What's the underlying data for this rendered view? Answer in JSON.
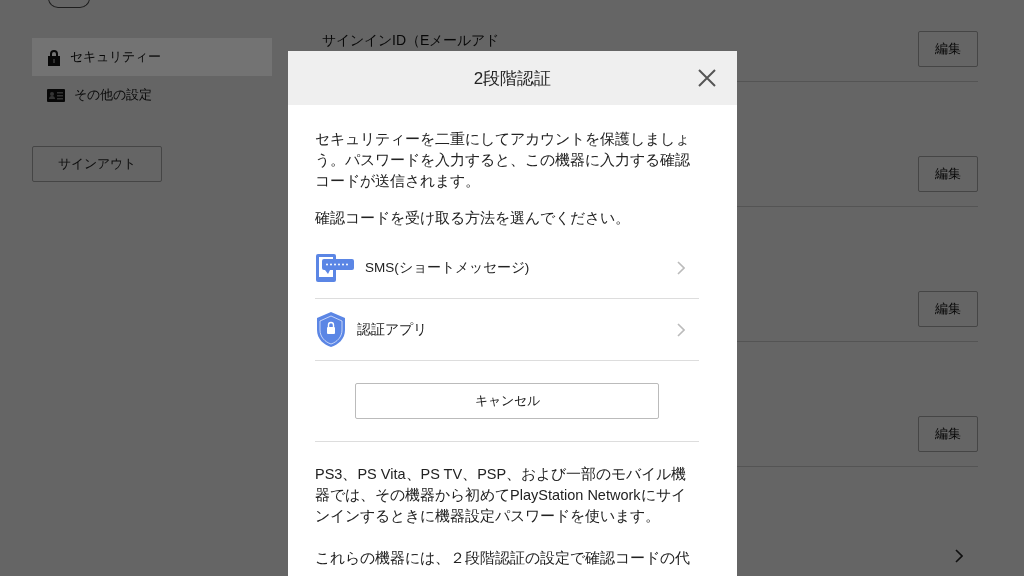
{
  "page": {
    "sidebar": {
      "items": [
        {
          "label": "セキュリティー",
          "kind": "lock",
          "selected": true
        },
        {
          "label": "その他の設定",
          "kind": "card",
          "selected": false
        }
      ],
      "signout": "サインアウト"
    },
    "section_title": "サインインID（Eメールアド",
    "edit_buttons": [
      "編集",
      "編集",
      "編集",
      "編集"
    ]
  },
  "dialog": {
    "title": "2段階認証",
    "intro": "セキュリティーを二重にしてアカウントを保護しましょう。パスワードを入力すると、この機器に入力する確認コードが送信されます。",
    "prompt": "確認コードを受け取る方法を選んでください。",
    "methods": [
      {
        "label": "SMS(ショートメッセージ)",
        "kind": "sms"
      },
      {
        "label": "認証アプリ",
        "kind": "app"
      }
    ],
    "cancel": "キャンセル",
    "notes": [
      "PS3、PS Vita、PS TV、PSP、および一部のモバイル機器では、その機器から初めてPlayStation Networkにサインインするときに機器設定パスワードを使います。",
      "これらの機器には、２段階認証の設定で確認コードの代"
    ]
  }
}
